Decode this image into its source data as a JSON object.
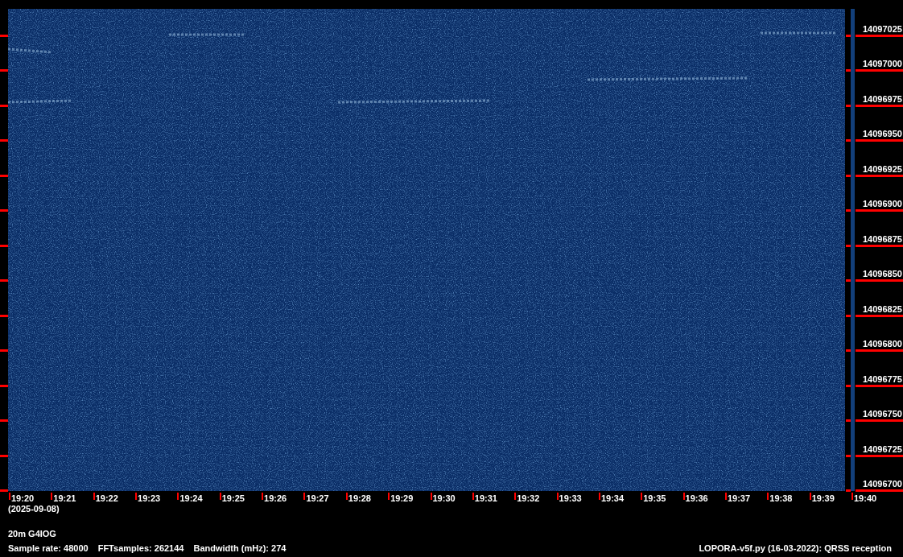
{
  "frequency_axis": {
    "ticks": [
      "14097025",
      "14097000",
      "14096975",
      "14096950",
      "14096925",
      "14096900",
      "14096875",
      "14096850",
      "14096825",
      "14096800",
      "14096775",
      "14096750",
      "14096725",
      "14096700"
    ]
  },
  "time_axis": {
    "ticks": [
      "19:20",
      "19:21",
      "19:22",
      "19:23",
      "19:24",
      "19:25",
      "19:26",
      "19:27",
      "19:28",
      "19:29",
      "19:30",
      "19:31",
      "19:32",
      "19:33",
      "19:34",
      "19:35",
      "19:36",
      "19:37",
      "19:38",
      "19:39",
      "19:40"
    ],
    "date": "(2025-09-08)"
  },
  "footer": {
    "station": "20m G4IOG",
    "parameters": [
      "Sample rate: 48000",
      "FFTsamples: 262144",
      "Bandwidth (mHz): 274"
    ],
    "program": "LOPORA-v5f.py (16-03-2022): QRSS reception"
  }
}
